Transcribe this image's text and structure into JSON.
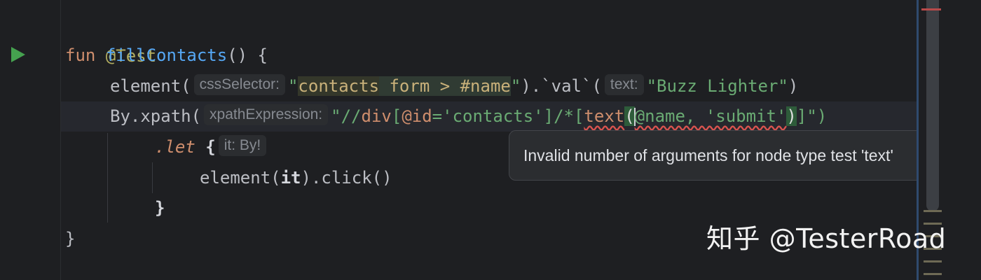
{
  "editor": {
    "lines": {
      "l1_annotation": "@Test",
      "l2_kw": "fun",
      "l2_name": "fillContacts",
      "l2_rest": "() {",
      "l3_call": "element(",
      "l3_hint": "cssSelector:",
      "l3_q1": "\"",
      "l3_sel_a": "contacts",
      "l3_sel_b": " form > #name",
      "l3_q2": "\"",
      "l3_mid": ").`val`(",
      "l3_hint2": "text:",
      "l3_str": "\"Buzz Lighter\"",
      "l3_end": ")",
      "l4_call": "By.xpath(",
      "l4_hint": "xpathExpression:",
      "l4_q1": "\"//",
      "l4_div": "div",
      "l4_b1": "[",
      "l4_attr": "@id",
      "l4_eq": "=",
      "l4_val": "'contacts'",
      "l4_b2": "]/*[",
      "l4_fn": "text",
      "l4_paren_open": "(",
      "l4_args": "@name, 'submit'",
      "l4_paren_close": ")",
      "l4_end": "]\")",
      "l5_let": ".let",
      "l5_brace": " {",
      "l5_hint": "it: By!",
      "l6_call": "element(",
      "l6_it": "it",
      "l6_rest": ").click()",
      "l7": "}",
      "l8": "}"
    }
  },
  "tooltip": {
    "message": "Invalid number of arguments for node type test 'text'"
  },
  "watermark": {
    "text": "知乎 @TesterRoad"
  },
  "icons": {
    "gutter_run": "run-triangle-icon",
    "intention": "lightbulb-icon"
  },
  "colors": {
    "background": "#1e1f22",
    "run_icon": "#45a14f",
    "error_underline": "#d9534f",
    "tooltip_bg": "#2b2d30"
  }
}
